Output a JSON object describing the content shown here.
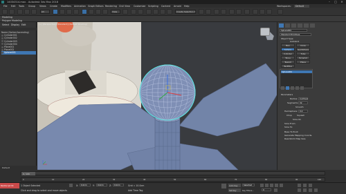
{
  "window": {
    "title": "14034314.max - Autodesk 3ds Max 2018",
    "controls": [
      "minimize-icon",
      "maximize-icon",
      "close-icon"
    ]
  },
  "menu": [
    "File",
    "Edit",
    "Tools",
    "Group",
    "Views",
    "Create",
    "Modifiers",
    "Animation",
    "Graph Editors",
    "Rendering",
    "Civil View",
    "Customize",
    "Scripting",
    "Content",
    "Arnold",
    "Help"
  ],
  "toolbar": {
    "selection_filter": "All",
    "named_selection": "Create Selection Set",
    "workspace_label": "Workspaces:",
    "workspace_value": "Default"
  },
  "ribbon": {
    "tab_label": "Modeling",
    "sub_label": "Polygon Modeling"
  },
  "explorer": {
    "tabs": [
      "Select",
      "Display",
      "Edit"
    ],
    "items": [
      {
        "label": "Name (Sorted Ascending)",
        "selected": false
      },
      {
        "label": "Cylinder001",
        "selected": false
      },
      {
        "label": "Cylinder002",
        "selected": false
      },
      {
        "label": "Cylinder003",
        "selected": false
      },
      {
        "label": "Cylinder004",
        "selected": false
      },
      {
        "label": "Plane001",
        "selected": false
      },
      {
        "label": "Plane002",
        "selected": false
      },
      {
        "label": "Sphere001",
        "selected": true
      }
    ],
    "footer_label": "Default"
  },
  "viewport": {
    "label": "[+] [Perspective] [Standard] [Default Shading]"
  },
  "command_panel": {
    "object_name": "Sphere001",
    "category": "Standard Primitives",
    "object_type_header": "Object Type",
    "autogrid": "AutoGrid",
    "buttons": [
      "Box",
      "Cone",
      "Sphere",
      "GeoSphere",
      "Cylinder",
      "Tube",
      "Torus",
      "Pyramid",
      "Teapot",
      "Plane",
      "TextPlus"
    ],
    "list_header": "Name and Color",
    "list_selected": "Sphere001",
    "params_header": "Parameters",
    "params": [
      {
        "label": "Radius:",
        "value": "5.975cm"
      },
      {
        "label": "Segments:",
        "value": "32"
      },
      {
        "label": "Smooth",
        "value": ""
      },
      {
        "label": "Hemisphere:",
        "value": "0.0"
      }
    ],
    "chop": "Chop",
    "squash": "Squash",
    "slice_on": "Slice On",
    "slice_from": "Slice From:",
    "slice_to": "Slice To:",
    "base_to_pivot": "Base To Pivot",
    "gen_mapping": "Generate Mapping Coords.",
    "real_world": "Real-World Map Size"
  },
  "timeline": {
    "frame": "0 / 100",
    "ticks": [
      "0",
      "10",
      "20",
      "30",
      "40",
      "50",
      "60",
      "70",
      "80",
      "90",
      "100"
    ]
  },
  "status": {
    "maxscript": "MAXScript Mi",
    "selected": "1 Object Selected",
    "hint": "Click and drag to select and move objects",
    "coords": [
      {
        "axis": "X:",
        "value": "0.0cm"
      },
      {
        "axis": "Y:",
        "value": "0.0cm"
      },
      {
        "axis": "Z:",
        "value": "0.0cm"
      }
    ],
    "grid": "Grid = 10.0cm",
    "addtime": "Add Time Tag",
    "autokey": "Auto Key",
    "selected_label": "Selected",
    "setkey": "Set Key",
    "keyfilters": "Key Filters..."
  },
  "colors": {
    "accent_blue": "#3f77b3",
    "sphere_wire": "#8fa7d6",
    "selection_cyan": "#5fe0e0",
    "viewport_bg": "#3e3f42"
  }
}
